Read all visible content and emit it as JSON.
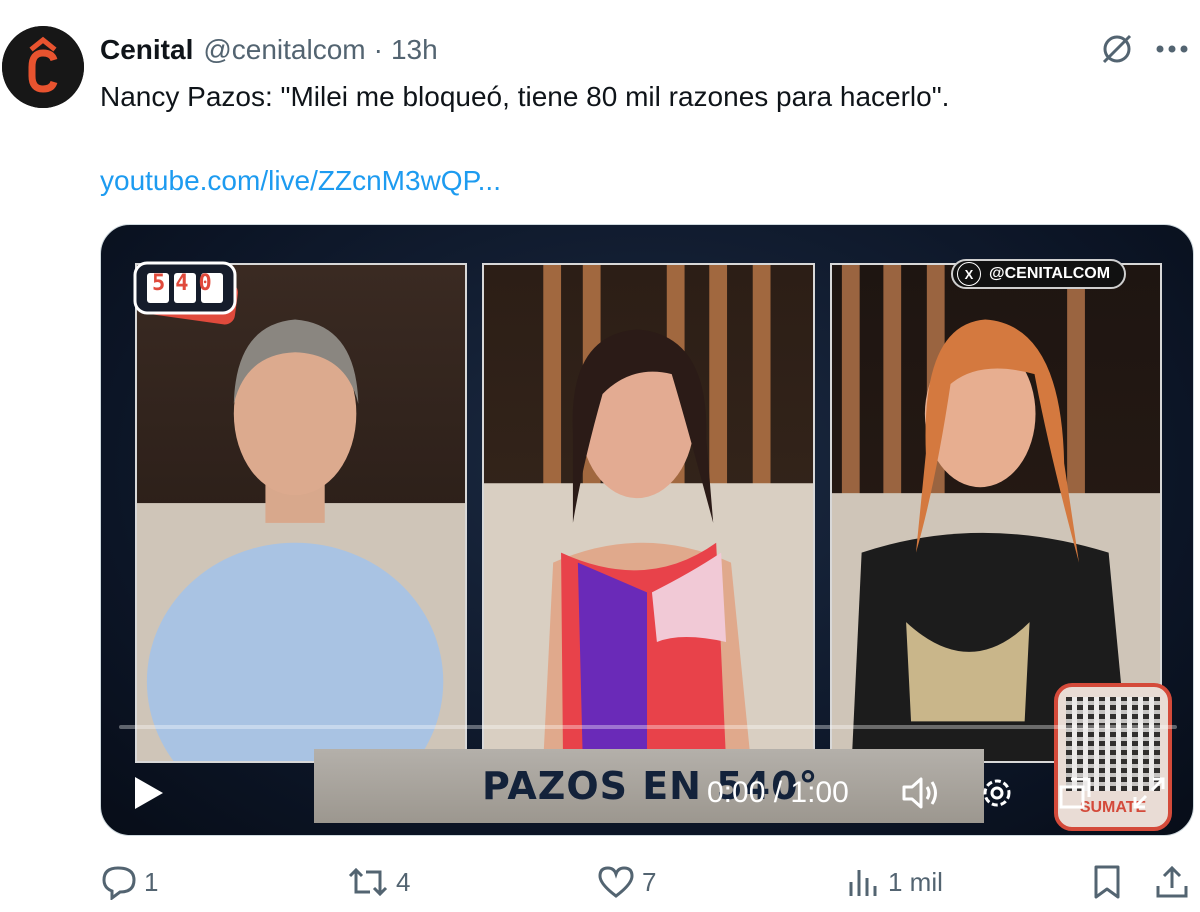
{
  "author": {
    "name": "Cenital",
    "handle": "@cenitalcom",
    "separator": "·",
    "time": "13h",
    "avatar_letter": "Ĉ"
  },
  "tweet": {
    "text": "Nancy Pazos: \"Milei me bloqueó, tiene 80 mil razones para hacerlo\".",
    "link": "youtube.com/live/ZZcnM3wQP..."
  },
  "video": {
    "show_logo": "540",
    "x_tag": "@CENITALCOM",
    "x_icon": "X",
    "banner": "PAZOS EN 540°",
    "qr_label": "SUMATE",
    "time_current": "0:00",
    "time_separator": " / ",
    "time_total": "1:00",
    "progress": 0
  },
  "actions": {
    "replies": "1",
    "reposts": "4",
    "likes": "7",
    "views": "1 mil"
  },
  "icons": [
    "grok-icon",
    "more-icon",
    "play-icon",
    "volume-icon",
    "settings-icon",
    "pip-icon",
    "fullscreen-icon",
    "reply-icon",
    "repost-icon",
    "like-icon",
    "views-icon",
    "bookmark-icon",
    "share-icon"
  ],
  "colors": {
    "link": "#1d9bf0",
    "muted": "#536471",
    "text": "#0f1419",
    "brand": "#e8532f"
  }
}
